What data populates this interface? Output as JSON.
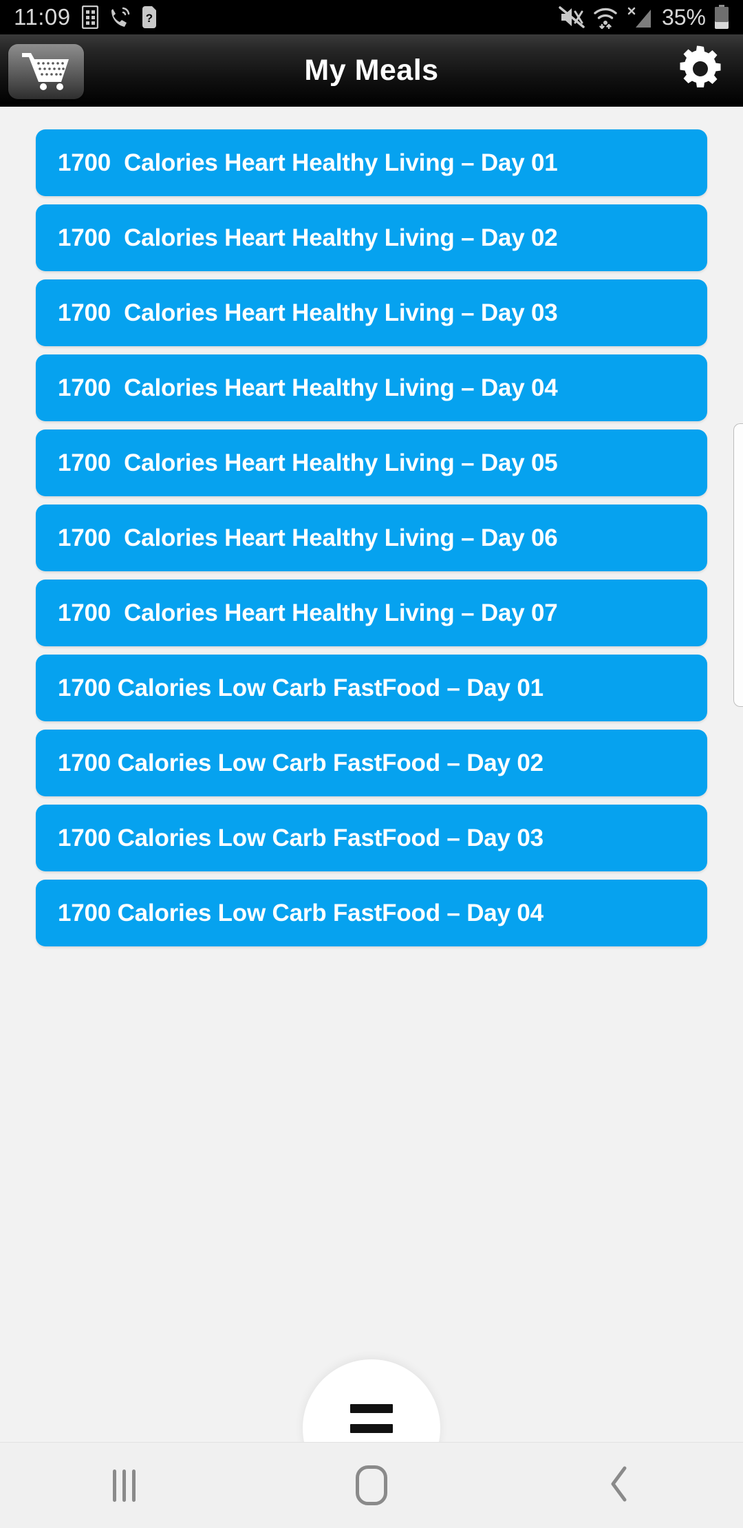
{
  "status_bar": {
    "time": "11:09",
    "battery_percent": "35%",
    "left_icons": [
      "sim-card-icon",
      "call-wifi-icon",
      "unknown-sim-icon"
    ],
    "right_icons": [
      "mute-icon",
      "wifi-icon",
      "no-signal-icon",
      "battery-icon"
    ],
    "colors": {
      "background": "#000000",
      "foreground": "#d8d8d8"
    }
  },
  "header": {
    "title": "My Meals",
    "cart_icon": "shopping-cart-icon",
    "settings_icon": "gear-icon",
    "colors": {
      "background": "#1a1a1a",
      "title": "#ffffff"
    }
  },
  "meal_list": {
    "accent_color": "#06a2ef",
    "text_color": "#ffffff",
    "items": [
      {
        "label": "1700  Calories Heart Healthy Living – Day 01"
      },
      {
        "label": "1700  Calories Heart Healthy Living – Day 02"
      },
      {
        "label": "1700  Calories Heart Healthy Living – Day 03"
      },
      {
        "label": "1700  Calories Heart Healthy Living – Day 04"
      },
      {
        "label": "1700  Calories Heart Healthy Living – Day 05"
      },
      {
        "label": "1700  Calories Heart Healthy Living – Day 06"
      },
      {
        "label": "1700  Calories Heart Healthy Living – Day 07"
      },
      {
        "label": "1700 Calories Low Carb FastFood – Day 01"
      },
      {
        "label": "1700 Calories Low Carb FastFood – Day 02"
      },
      {
        "label": "1700 Calories Low Carb FastFood – Day 03"
      },
      {
        "label": "1700 Calories Low Carb FastFood – Day 04"
      }
    ]
  },
  "fab": {
    "icon": "hamburger-menu-icon"
  },
  "nav_bar": {
    "recents_icon": "recents-icon",
    "home_icon": "home-icon",
    "back_icon": "back-chevron-icon",
    "colors": {
      "background": "#f0f0f0",
      "foreground": "#8a8a8a"
    }
  }
}
